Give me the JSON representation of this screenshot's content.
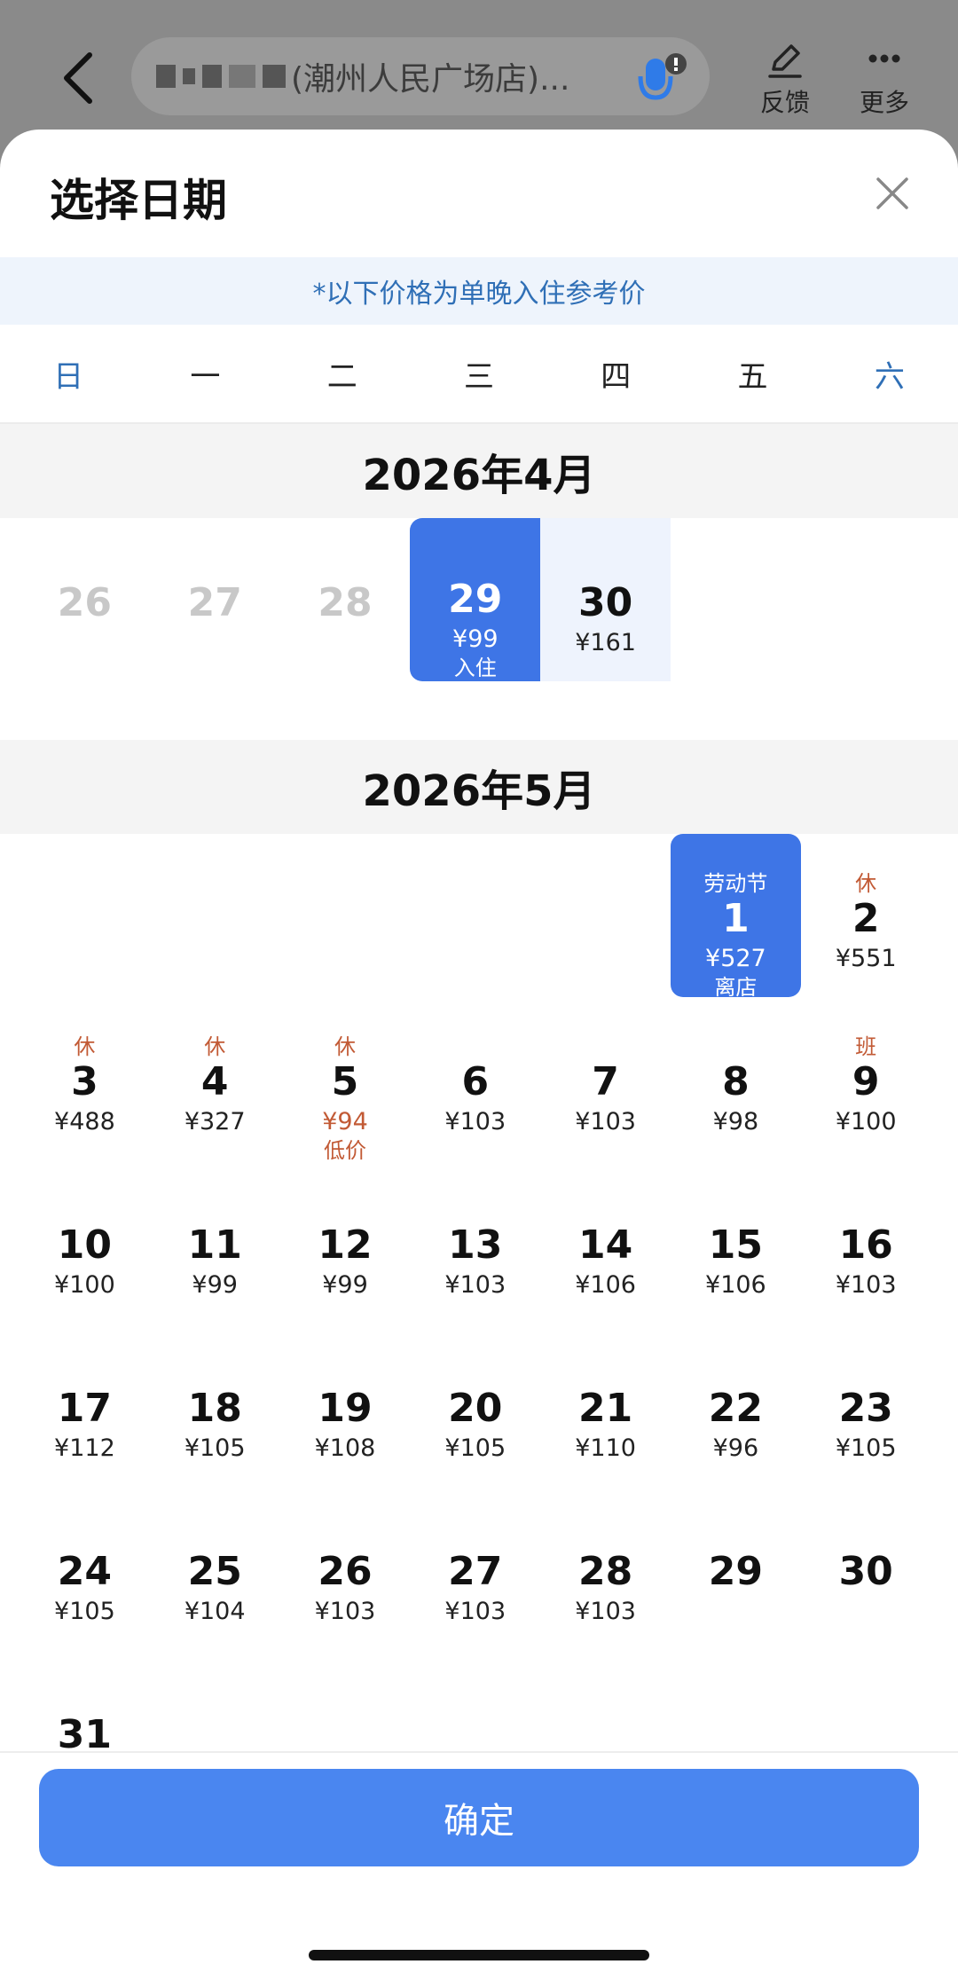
{
  "header": {
    "search_text": "(潮州人民广场店)...",
    "feedback_label": "反馈",
    "more_label": "更多"
  },
  "sheet": {
    "title": "选择日期",
    "price_note": "*以下价格为单晚入住参考价",
    "weekdays": [
      "日",
      "一",
      "二",
      "三",
      "四",
      "五",
      "六"
    ]
  },
  "april": {
    "title": "2026年4月",
    "days": [
      {
        "num": "26",
        "state": "past",
        "tag": "",
        "price": "",
        "sub": ""
      },
      {
        "num": "27",
        "state": "past",
        "tag": "",
        "price": "",
        "sub": ""
      },
      {
        "num": "28",
        "state": "past",
        "tag": "",
        "price": "",
        "sub": ""
      },
      {
        "num": "29",
        "state": "selected",
        "tag": "",
        "price": "¥99",
        "sub": "入住"
      },
      {
        "num": "30",
        "state": "in-range",
        "tag": "",
        "price": "¥161",
        "sub": ""
      }
    ]
  },
  "may": {
    "title": "2026年5月",
    "leading_blanks": 5,
    "days": [
      {
        "num": "1",
        "state": "selected-end",
        "tag": "劳动节",
        "price": "¥527",
        "sub": "离店"
      },
      {
        "num": "2",
        "state": "",
        "tag": "休",
        "price": "¥551",
        "sub": ""
      },
      {
        "num": "3",
        "state": "",
        "tag": "休",
        "price": "¥488",
        "sub": ""
      },
      {
        "num": "4",
        "state": "",
        "tag": "休",
        "price": "¥327",
        "sub": ""
      },
      {
        "num": "5",
        "state": "low",
        "tag": "休",
        "price": "¥94",
        "sub": "低价"
      },
      {
        "num": "6",
        "state": "",
        "tag": "",
        "price": "¥103",
        "sub": ""
      },
      {
        "num": "7",
        "state": "",
        "tag": "",
        "price": "¥103",
        "sub": ""
      },
      {
        "num": "8",
        "state": "",
        "tag": "",
        "price": "¥98",
        "sub": ""
      },
      {
        "num": "9",
        "state": "",
        "tag": "班",
        "price": "¥100",
        "sub": ""
      },
      {
        "num": "10",
        "state": "",
        "tag": "",
        "price": "¥100",
        "sub": ""
      },
      {
        "num": "11",
        "state": "",
        "tag": "",
        "price": "¥99",
        "sub": ""
      },
      {
        "num": "12",
        "state": "",
        "tag": "",
        "price": "¥99",
        "sub": ""
      },
      {
        "num": "13",
        "state": "",
        "tag": "",
        "price": "¥103",
        "sub": ""
      },
      {
        "num": "14",
        "state": "",
        "tag": "",
        "price": "¥106",
        "sub": ""
      },
      {
        "num": "15",
        "state": "",
        "tag": "",
        "price": "¥106",
        "sub": ""
      },
      {
        "num": "16",
        "state": "",
        "tag": "",
        "price": "¥103",
        "sub": ""
      },
      {
        "num": "17",
        "state": "",
        "tag": "",
        "price": "¥112",
        "sub": ""
      },
      {
        "num": "18",
        "state": "",
        "tag": "",
        "price": "¥105",
        "sub": ""
      },
      {
        "num": "19",
        "state": "",
        "tag": "",
        "price": "¥108",
        "sub": ""
      },
      {
        "num": "20",
        "state": "",
        "tag": "",
        "price": "¥105",
        "sub": ""
      },
      {
        "num": "21",
        "state": "",
        "tag": "",
        "price": "¥110",
        "sub": ""
      },
      {
        "num": "22",
        "state": "",
        "tag": "",
        "price": "¥96",
        "sub": ""
      },
      {
        "num": "23",
        "state": "",
        "tag": "",
        "price": "¥105",
        "sub": ""
      },
      {
        "num": "24",
        "state": "",
        "tag": "",
        "price": "¥105",
        "sub": ""
      },
      {
        "num": "25",
        "state": "",
        "tag": "",
        "price": "¥104",
        "sub": ""
      },
      {
        "num": "26",
        "state": "",
        "tag": "",
        "price": "¥103",
        "sub": ""
      },
      {
        "num": "27",
        "state": "",
        "tag": "",
        "price": "¥103",
        "sub": ""
      },
      {
        "num": "28",
        "state": "",
        "tag": "",
        "price": "¥103",
        "sub": ""
      },
      {
        "num": "29",
        "state": "",
        "tag": "",
        "price": "",
        "sub": ""
      },
      {
        "num": "30",
        "state": "",
        "tag": "",
        "price": "",
        "sub": ""
      },
      {
        "num": "31",
        "state": "",
        "tag": "",
        "price": "",
        "sub": ""
      }
    ]
  },
  "footer": {
    "confirm_label": "确定"
  },
  "colors": {
    "accent": "#3e75e6",
    "holiday": "#c25a35",
    "weekend_header": "#2f6fb6"
  }
}
